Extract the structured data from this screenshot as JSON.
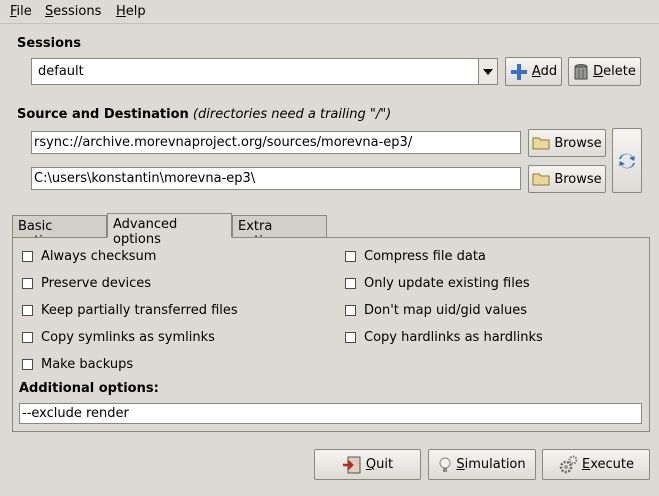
{
  "menu": [
    {
      "label": "File",
      "key": "F",
      "rest": "ile"
    },
    {
      "label": "Sessions",
      "key": "S",
      "rest": "essions"
    },
    {
      "label": "Help",
      "key": "H",
      "rest": "elp"
    }
  ],
  "sessions": {
    "title": "Sessions",
    "selected": "default",
    "add_key": "A",
    "add_rest": "dd",
    "delete_key": "D",
    "delete_rest": "elete"
  },
  "source_dest": {
    "title": "Source and Destination",
    "hint": "(directories need a trailing \"/\")",
    "source": "rsync://archive.morevnaproject.org/sources/morevna-ep3/",
    "destination": "C:\\users\\konstantin\\morevna-ep3\\",
    "browse_label": "Browse"
  },
  "tabs": [
    "Basic options",
    "Advanced options",
    "Extra options"
  ],
  "active_tab": "Advanced options",
  "options_left": [
    "Always checksum",
    "Preserve devices",
    "Keep partially transferred files",
    "Copy symlinks as symlinks",
    "Make backups"
  ],
  "options_right": [
    "Compress file data",
    "Only update existing files",
    "Don't map uid/gid values",
    "Copy hardlinks as hardlinks"
  ],
  "additional": {
    "label": "Additional options:",
    "value": "--exclude render"
  },
  "footer": {
    "quit_key": "Q",
    "quit_rest": "uit",
    "simulation_key": "S",
    "simulation_rest": "imulation",
    "execute_key": "E",
    "execute_rest": "xecute"
  },
  "colors": {
    "window_bg": "#dcdad5",
    "border": "#8a877f",
    "add_icon": "#3a6fd1",
    "swap_icon": "#2f6fc0"
  }
}
